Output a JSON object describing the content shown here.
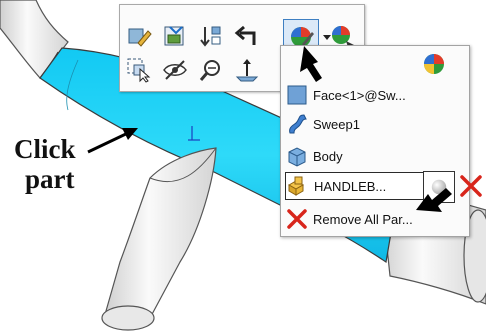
{
  "callout": {
    "line1": "Click",
    "line2": "part"
  },
  "toolbar": {
    "buttons": [
      {
        "name": "edit-part-icon"
      },
      {
        "name": "edit-sketch-icon"
      },
      {
        "name": "sort-icon"
      },
      {
        "name": "undo-arrow-icon"
      },
      {
        "name": "appearance-icon",
        "selected": true
      },
      {
        "name": "dropdown-arrow-icon"
      },
      {
        "name": "appearance-alt-icon"
      },
      {
        "name": "select-other-icon"
      },
      {
        "name": "hide-icon"
      },
      {
        "name": "zoom-to-selection-icon"
      },
      {
        "name": "normal-to-icon"
      }
    ]
  },
  "menu": {
    "items": [
      {
        "label": "Face<1>@Sw...",
        "icon": "face-icon"
      },
      {
        "label": "Sweep1",
        "icon": "sweep-icon"
      },
      {
        "label": "Body",
        "icon": "body-icon"
      },
      {
        "label": "HANDLEB...",
        "icon": "part-icon",
        "highlighted": true
      },
      {
        "label": "Remove All Par...",
        "icon": "remove-icon"
      }
    ]
  },
  "colors": {
    "tube_blue": "#14d2f8",
    "selection_border": "#3e7fc2",
    "remove_red": "#d8251b"
  }
}
